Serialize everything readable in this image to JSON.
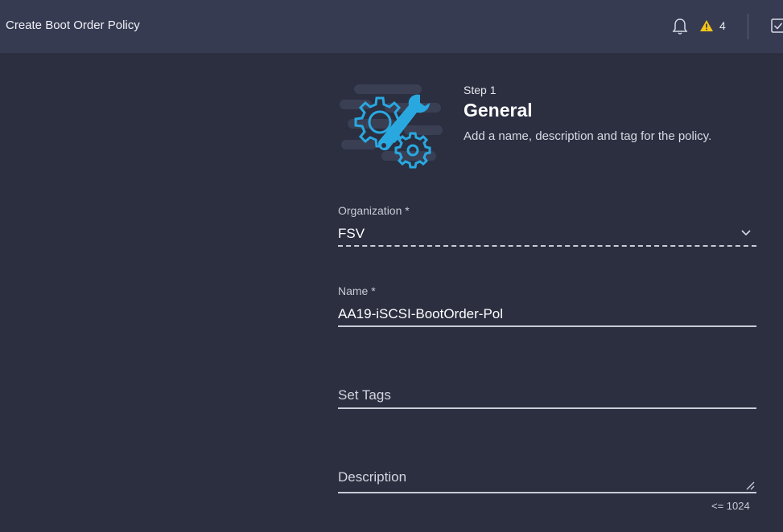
{
  "header": {
    "title": "Create Boot Order Policy",
    "notifications_icon": "bell-icon",
    "warning_icon": "warning-triangle-icon",
    "warning_count": "4",
    "warning_color": "#f5c518",
    "tasks_icon": "checkbox-icon"
  },
  "step": {
    "label": "Step 1",
    "title": "General",
    "description": "Add a name, description and tag for the policy.",
    "illustration_icon": "gear-wrench-icon",
    "accent": "#29a8e0"
  },
  "form": {
    "organization": {
      "label": "Organization *",
      "value": "FSV"
    },
    "name": {
      "label": "Name *",
      "value": "AA19-iSCSI-BootOrder-Pol"
    },
    "tags": {
      "placeholder": "Set Tags"
    },
    "description": {
      "placeholder": "Description",
      "char_limit": "<= 1024"
    }
  }
}
